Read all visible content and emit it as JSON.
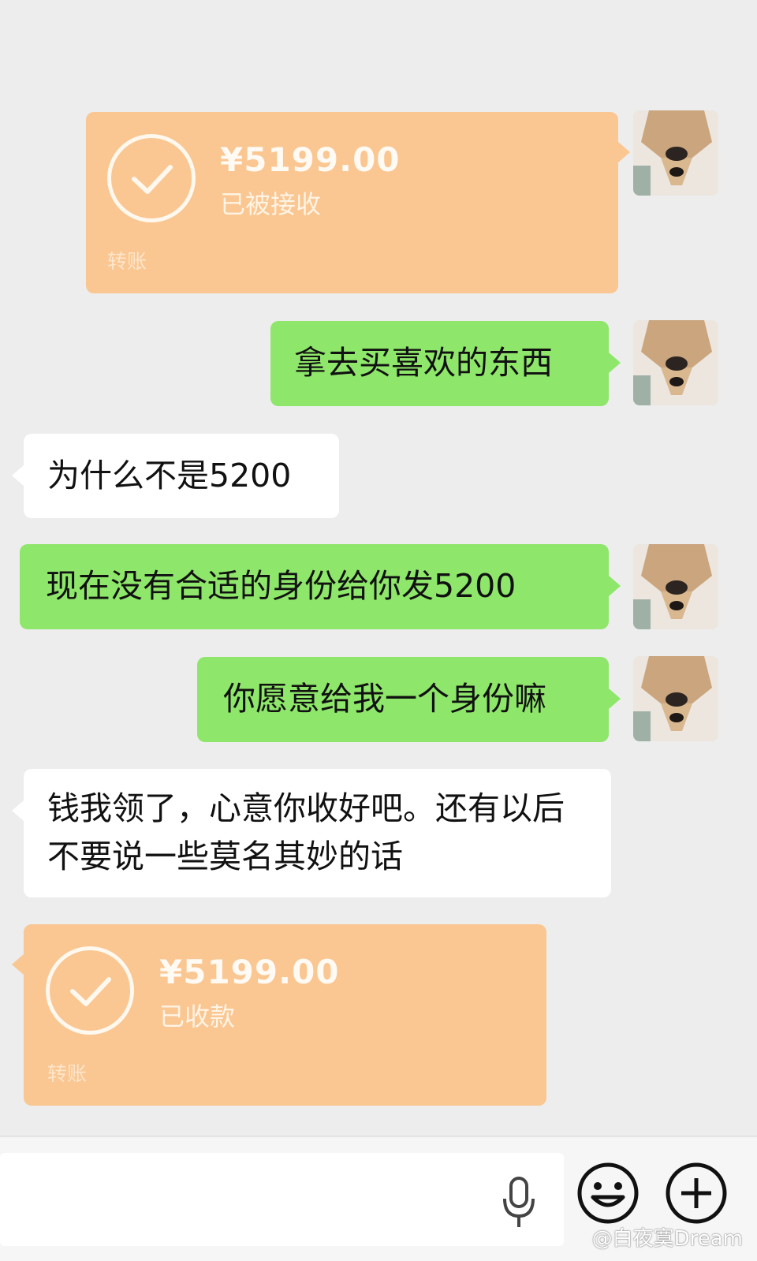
{
  "header": {
    "title": ""
  },
  "messages": [
    {
      "type": "transfer",
      "side": "right",
      "amount": "¥5199.00",
      "status": "已被接收",
      "label": "转账"
    },
    {
      "type": "text",
      "side": "right",
      "text": "拿去买喜欢的东西"
    },
    {
      "type": "text",
      "side": "left",
      "text": "为什么不是5200"
    },
    {
      "type": "text",
      "side": "right",
      "text": "现在没有合适的身份给你发5200"
    },
    {
      "type": "text",
      "side": "right",
      "text": "你愿意给我一个身份嘛"
    },
    {
      "type": "text",
      "side": "left",
      "text": "钱我领了，心意你收好吧。还有以后不要说一些莫名其妙的话"
    },
    {
      "type": "transfer",
      "side": "left",
      "amount": "¥5199.00",
      "status": "已收款",
      "label": "转账"
    }
  ],
  "input_bar": {
    "icons": [
      "microphone-icon",
      "emoji-icon",
      "plus-icon"
    ]
  },
  "watermark": "@白夜寞Dream",
  "colors": {
    "background": "#ededed",
    "sent_bubble": "#8ee76a",
    "received_bubble": "#ffffff",
    "transfer_bubble": "#fac691"
  }
}
